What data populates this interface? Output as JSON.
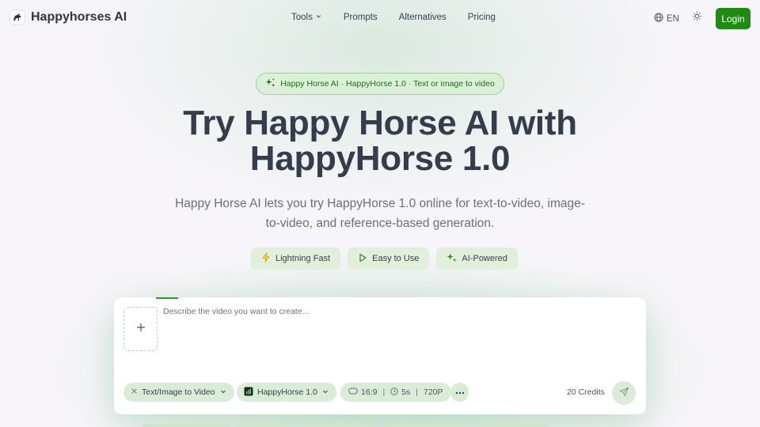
{
  "brand": {
    "name": "Happyhorses AI",
    "logo_icon": "horse-logo-icon"
  },
  "nav": {
    "items": [
      {
        "label": "Tools",
        "has_dropdown": true
      },
      {
        "label": "Prompts"
      },
      {
        "label": "Alternatives"
      },
      {
        "label": "Pricing"
      }
    ]
  },
  "header": {
    "language": "EN",
    "theme_icon": "sun-icon",
    "login_label": "Login"
  },
  "badge": {
    "text": "Happy Horse AI · HappyHorse 1.0 · Text or image to video",
    "icon": "sparkles-icon"
  },
  "hero": {
    "title_line1": "Try Happy Horse AI with",
    "title_line2": "HappyHorse 1.0",
    "subtitle": "Happy Horse AI lets you try HappyHorse 1.0 online for text-to-video, image-to-video, and reference-based generation."
  },
  "features": [
    {
      "label": "Lightning Fast",
      "icon": "lightning-icon"
    },
    {
      "label": "Easy to Use",
      "icon": "play-icon"
    },
    {
      "label": "AI-Powered",
      "icon": "sparkles-icon"
    }
  ],
  "composer": {
    "placeholder": "Describe the video you want to create...",
    "mode_label": "Text/Image to Video",
    "model_label": "HappyHorse 1.0",
    "aspect_ratio": "16:9",
    "duration": "5s",
    "resolution": "720P",
    "credits": "20 Credits"
  },
  "colors": {
    "accent": "#1f8a14",
    "badge_bg": "#dcefd8",
    "pill_bg": "#e2efdd"
  }
}
